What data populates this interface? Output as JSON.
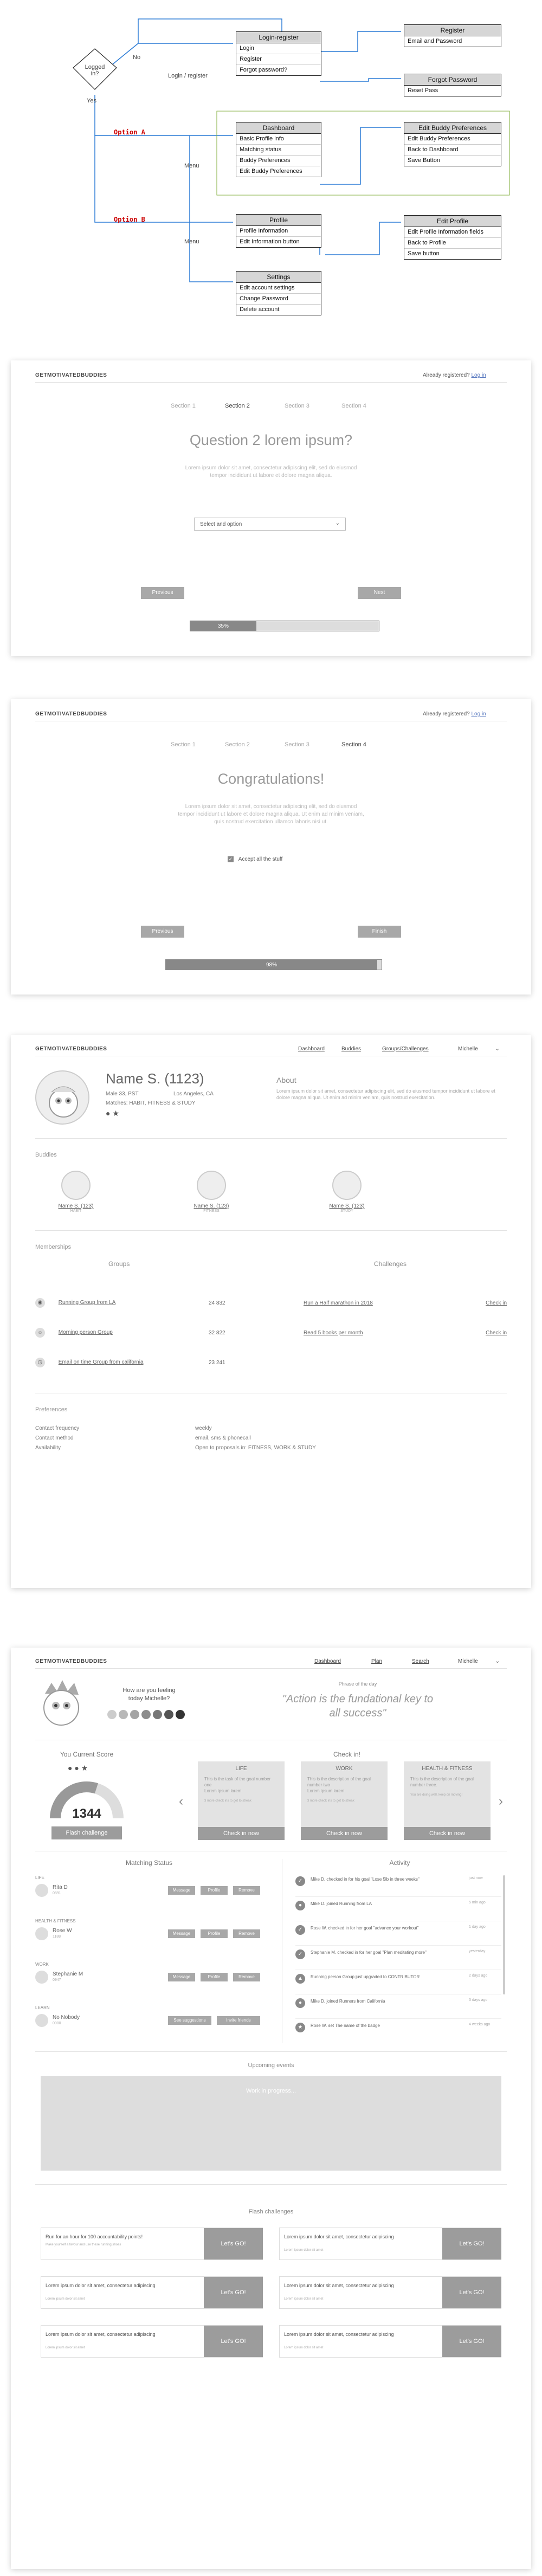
{
  "flowchart": {
    "decision": "Logged in?",
    "yes": "Yes",
    "no": "No",
    "login_register_label": "Login / register",
    "menu1": "Menu",
    "menu2": "Menu",
    "option_a": "Option A",
    "option_b": "Option B",
    "login": {
      "title": "Login-register",
      "items": [
        "Login",
        "Register",
        "Forgot password?"
      ]
    },
    "register": {
      "title": "Register",
      "items": [
        "Email and Password"
      ]
    },
    "forgot": {
      "title": "Forgot Password",
      "items": [
        "Reset Pass"
      ]
    },
    "dashboard": {
      "title": "Dashboard",
      "items": [
        "Basic Profile info",
        "Matching status",
        "Buddy Preferences",
        "Edit Buddy Preferences"
      ]
    },
    "edit_buddy": {
      "title": "Edit Buddy Preferences",
      "items": [
        "Edit Buddy Preferences",
        "Back to Dashboard",
        "Save Button"
      ]
    },
    "profile": {
      "title": "Profile",
      "items": [
        "Profile Information",
        "Edit Information button"
      ]
    },
    "edit_profile": {
      "title": "Edit Profile",
      "items": [
        "Edit Profile Information fields",
        "Back to Profile",
        "Save button"
      ]
    },
    "settings": {
      "title": "Settings",
      "items": [
        "Edit account settings",
        "Change Password",
        "Delete account"
      ]
    }
  },
  "brand": "GETMOTIVATEDBUDDIES",
  "registered": {
    "text": "Already registered?",
    "link": "Log in"
  },
  "survey1": {
    "steps": [
      "Section 1",
      "Section 2",
      "Section 3",
      "Section 4"
    ],
    "title": "Question 2 lorem ipsum?",
    "subtitle": [
      "Lorem ipsum dolor sit amet, consectetur adipiscing elit, sed do eiusmod",
      "tempor incididunt ut labore et dolore magna aliqua."
    ],
    "select": "Select and option",
    "prev": "Previous",
    "next": "Next",
    "progress": "35%",
    "progress_value": 0.35
  },
  "survey2": {
    "steps": [
      "Section 1",
      "Section 2",
      "Section 3",
      "Section 4"
    ],
    "title": "Congratulations!",
    "subtitle": [
      "Lorem ipsum dolor sit amet, consectetur adipiscing elit, sed do eiusmod",
      "tempor incididunt ut labore et dolore magna aliqua. Ut enim ad minim veniam,",
      "quis nostrud exercitation ullamco laboris nisi ut."
    ],
    "accept": "Accept all the stuff",
    "prev": "Previous",
    "next": "Finish",
    "progress": "98%",
    "progress_value": 0.98
  },
  "profile": {
    "nav": [
      "Dashboard",
      "Buddies",
      "Groups/Challenges",
      "Michelle"
    ],
    "name": "Name S. (1123)",
    "meta1": "Male 33, PST",
    "location": "Los Angeles, CA",
    "matches": "Matches: HABIT, FITNESS & STUDY",
    "about_title": "About",
    "about": "Lorem ipsum dolor sit amet, consectetur adipiscing elit, sed do eiusmod tempor incididunt ut labore et dolore magna aliqua. Ut enim ad minim veniam, quis nostrud exercitation.",
    "buddies_title": "Buddies",
    "buddies": [
      {
        "name": "Name S. (123)",
        "tag": "HABIT"
      },
      {
        "name": "Name S. (123)",
        "tag": "FITNESS"
      },
      {
        "name": "Name S. (123)",
        "tag": "STUDY"
      }
    ],
    "memberships_title": "Memberships",
    "groups_title": "Groups",
    "challenges_title": "Challenges",
    "groups": [
      {
        "name": "Running Group from LA",
        "count": "24 832"
      },
      {
        "name": "Morning person Group",
        "count": "32 822"
      },
      {
        "name": "Email on time Group from california",
        "count": "23 241"
      }
    ],
    "challenges": [
      {
        "name": "Run a Half marathon in 2018",
        "action": "Check in"
      },
      {
        "name": "Read 5 books per month",
        "action": "Check in"
      }
    ],
    "prefs_title": "Preferences",
    "prefs": [
      {
        "k": "Contact frequency",
        "v": "weekly"
      },
      {
        "k": "Contact method",
        "v": "email, sms & phonecall"
      },
      {
        "k": "Availability",
        "v": "Open to proposals in: FITNESS, WORK & STUDY"
      }
    ]
  },
  "dash": {
    "nav": [
      "Dashboard",
      "Plan",
      "Search",
      "Michelle"
    ],
    "feeling": [
      "How are you feeling",
      "today Michelle?"
    ],
    "phrase_label": "Phrase of the day",
    "phrase": [
      "\"Action is the fundational key to",
      "all success\""
    ],
    "score_title": "You Current Score",
    "score": "1344",
    "score_fill": 0.6,
    "flash_btn": "Flash challenge",
    "checkin_title": "Check in!",
    "checkins": [
      {
        "title": "LIFE",
        "text": "This is the task of the goal number one",
        "sub": "Lorem ipsum lorem",
        "note": "3 more check ins to get to streak",
        "btn": "Check in now"
      },
      {
        "title": "WORK",
        "text": "This is the description of the goal number two",
        "sub": "Lorem ipsum lorem",
        "note": "3 more check ins to get to streak",
        "btn": "Check in now"
      },
      {
        "title": "HEALTH & FITNESS",
        "text": "This is the description of the goal number three.",
        "sub": "",
        "note": "You are doing well, keep on moving!",
        "btn": "Check in now"
      }
    ],
    "match_title": "Matching Status",
    "matches": [
      {
        "section": "LIFE",
        "name": "Rita D",
        "id": "0891",
        "btns": [
          "Message",
          "Profile",
          "Remove"
        ]
      },
      {
        "section": "HEALTH & FITNESS",
        "name": "Rose W",
        "id": "1188",
        "btns": [
          "Message",
          "Profile",
          "Remove"
        ]
      },
      {
        "section": "WORK",
        "name": "Stephanie M",
        "id": "0947",
        "btns": [
          "Message",
          "Profile",
          "Remove"
        ]
      },
      {
        "section": "LEARN",
        "name": "No Nobody",
        "id": "0000",
        "btns": [
          "See suggestions",
          "Invite friends"
        ]
      }
    ],
    "activity_title": "Activity",
    "activity": [
      {
        "text": "Mike D. checked in for his goal \"Lose 5lb in three weeks\"",
        "time": "just now"
      },
      {
        "text": "Mike D. joined Running from LA",
        "time": "5 min ago"
      },
      {
        "text": "Rose W. checked in for her goal \"advance your workout\"",
        "time": "1 day ago"
      },
      {
        "text": "Stephanie M. checked in for her goal \"Plan meditating more\"",
        "time": "yesterday"
      },
      {
        "text": "Running person Group just upgraded to CONTRIBUTOR",
        "time": "2 days ago"
      },
      {
        "text": "Mike D. joined Runners from California",
        "time": "3 days ago"
      },
      {
        "text": "Rose W. set The name of the badge",
        "time": "4 weeks ago"
      }
    ],
    "events_title": "Upcoming events",
    "events_placeholder": "Work in progress...",
    "flash_title": "Flash challenges",
    "flash": [
      {
        "text": "Run for an hour for 100 accountability points!",
        "sub": "Make yourself a favour and use these running shoes",
        "btn": "Let's GO!"
      },
      {
        "text": "Lorem ipsum dolor sit amet, consectetur adipiscing",
        "sub": "Lorem ipsum dolor sit amet",
        "btn": "Let's GO!"
      },
      {
        "text": "Lorem ipsum dolor sit amet, consectetur adipiscing",
        "sub": "Lorem ipsum dolor sit amet",
        "btn": "Let's GO!"
      },
      {
        "text": "Lorem ipsum dolor sit amet, consectetur adipiscing",
        "sub": "Lorem ipsum dolor sit amet",
        "btn": "Let's GO!"
      },
      {
        "text": "Lorem ipsum dolor sit amet, consectetur adipiscing",
        "sub": "Lorem ipsum dolor sit amet",
        "btn": "Let's GO!"
      },
      {
        "text": "Lorem ipsum dolor sit amet, consectetur adipiscing",
        "sub": "Lorem ipsum dolor sit amet",
        "btn": "Let's GO!"
      }
    ]
  }
}
